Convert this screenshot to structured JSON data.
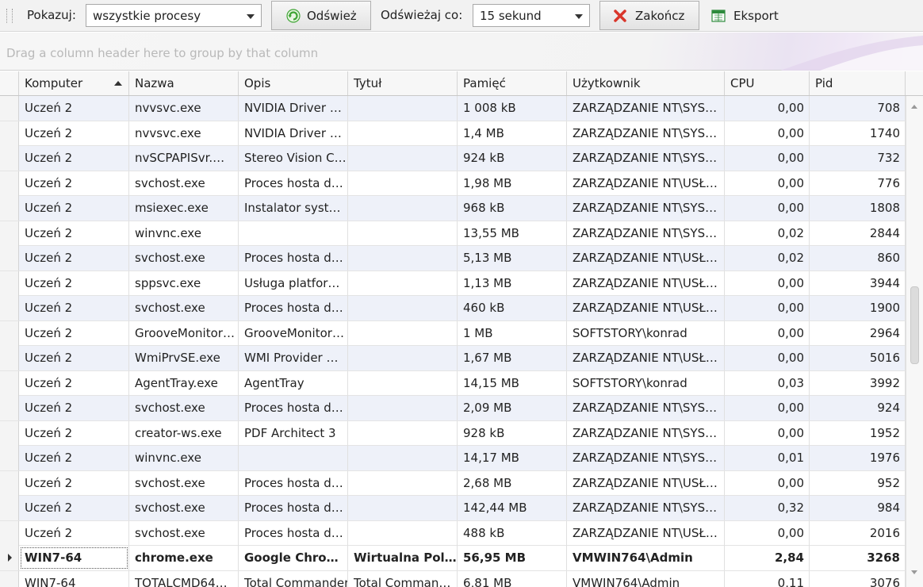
{
  "toolbar": {
    "show_label": "Pokazuj:",
    "show_value": "wszystkie procesy",
    "refresh_label": "Odśwież",
    "refresh_every_label": "Odświeżaj co:",
    "refresh_every_value": "15 sekund",
    "kill_label": "Zakończ",
    "export_label": "Eksport"
  },
  "group_panel": {
    "placeholder": "Drag a column header here to group by that column"
  },
  "columns": [
    "Komputer",
    "Nazwa",
    "Opis",
    "Tytuł",
    "Pamięć",
    "Użytkownik",
    "CPU",
    "Pid"
  ],
  "sorted_column": "Komputer",
  "rows": [
    {
      "komputer": "Uczeń 2",
      "nazwa": "nvvsvc.exe",
      "opis": "NVIDIA Driver …",
      "tytul": "",
      "pamiec": "1 008 kB",
      "uzytkownik": "ZARZĄDZANIE NT\\SYS…",
      "cpu": "0,00",
      "pid": "708"
    },
    {
      "komputer": "Uczeń 2",
      "nazwa": "nvvsvc.exe",
      "opis": "NVIDIA Driver …",
      "tytul": "",
      "pamiec": "1,4 MB",
      "uzytkownik": "ZARZĄDZANIE NT\\SYS…",
      "cpu": "0,00",
      "pid": "1740"
    },
    {
      "komputer": "Uczeń 2",
      "nazwa": "nvSCPAPISvr.…",
      "opis": "Stereo Vision C…",
      "tytul": "",
      "pamiec": "924 kB",
      "uzytkownik": "ZARZĄDZANIE NT\\SYS…",
      "cpu": "0,00",
      "pid": "732"
    },
    {
      "komputer": "Uczeń 2",
      "nazwa": "svchost.exe",
      "opis": "Proces hosta d…",
      "tytul": "",
      "pamiec": "1,98 MB",
      "uzytkownik": "ZARZĄDZANIE NT\\USŁ…",
      "cpu": "0,00",
      "pid": "776"
    },
    {
      "komputer": "Uczeń 2",
      "nazwa": "msiexec.exe",
      "opis": "Instalator syst…",
      "tytul": "",
      "pamiec": "968 kB",
      "uzytkownik": "ZARZĄDZANIE NT\\SYS…",
      "cpu": "0,00",
      "pid": "1808"
    },
    {
      "komputer": "Uczeń 2",
      "nazwa": "winvnc.exe",
      "opis": "",
      "tytul": "",
      "pamiec": "13,55 MB",
      "uzytkownik": "ZARZĄDZANIE NT\\SYS…",
      "cpu": "0,02",
      "pid": "2844"
    },
    {
      "komputer": "Uczeń 2",
      "nazwa": "svchost.exe",
      "opis": "Proces hosta d…",
      "tytul": "",
      "pamiec": "5,13 MB",
      "uzytkownik": "ZARZĄDZANIE NT\\USŁ…",
      "cpu": "0,02",
      "pid": "860"
    },
    {
      "komputer": "Uczeń 2",
      "nazwa": "sppsvc.exe",
      "opis": "Usługa platfor…",
      "tytul": "",
      "pamiec": "1,13 MB",
      "uzytkownik": "ZARZĄDZANIE NT\\USŁ…",
      "cpu": "0,00",
      "pid": "3944"
    },
    {
      "komputer": "Uczeń 2",
      "nazwa": "svchost.exe",
      "opis": "Proces hosta d…",
      "tytul": "",
      "pamiec": "460 kB",
      "uzytkownik": "ZARZĄDZANIE NT\\USŁ…",
      "cpu": "0,00",
      "pid": "1900"
    },
    {
      "komputer": "Uczeń 2",
      "nazwa": "GrooveMonitor…",
      "opis": "GrooveMonitor…",
      "tytul": "",
      "pamiec": "1 MB",
      "uzytkownik": "SOFTSTORY\\konrad",
      "cpu": "0,00",
      "pid": "2964"
    },
    {
      "komputer": "Uczeń 2",
      "nazwa": "WmiPrvSE.exe",
      "opis": "WMI Provider …",
      "tytul": "",
      "pamiec": "1,67 MB",
      "uzytkownik": "ZARZĄDZANIE NT\\USŁ…",
      "cpu": "0,00",
      "pid": "5016"
    },
    {
      "komputer": "Uczeń 2",
      "nazwa": "AgentTray.exe",
      "opis": "AgentTray",
      "tytul": "",
      "pamiec": "14,15 MB",
      "uzytkownik": "SOFTSTORY\\konrad",
      "cpu": "0,03",
      "pid": "3992"
    },
    {
      "komputer": "Uczeń 2",
      "nazwa": "svchost.exe",
      "opis": "Proces hosta d…",
      "tytul": "",
      "pamiec": "2,09 MB",
      "uzytkownik": "ZARZĄDZANIE NT\\SYS…",
      "cpu": "0,00",
      "pid": "924"
    },
    {
      "komputer": "Uczeń 2",
      "nazwa": "creator-ws.exe",
      "opis": "PDF Architect 3",
      "tytul": "",
      "pamiec": "928 kB",
      "uzytkownik": "ZARZĄDZANIE NT\\SYS…",
      "cpu": "0,00",
      "pid": "1952"
    },
    {
      "komputer": "Uczeń 2",
      "nazwa": "winvnc.exe",
      "opis": "",
      "tytul": "",
      "pamiec": "14,17 MB",
      "uzytkownik": "ZARZĄDZANIE NT\\SYS…",
      "cpu": "0,01",
      "pid": "1976"
    },
    {
      "komputer": "Uczeń 2",
      "nazwa": "svchost.exe",
      "opis": "Proces hosta d…",
      "tytul": "",
      "pamiec": "2,68 MB",
      "uzytkownik": "ZARZĄDZANIE NT\\USŁ…",
      "cpu": "0,00",
      "pid": "952"
    },
    {
      "komputer": "Uczeń 2",
      "nazwa": "svchost.exe",
      "opis": "Proces hosta d…",
      "tytul": "",
      "pamiec": "142,44 MB",
      "uzytkownik": "ZARZĄDZANIE NT\\SYS…",
      "cpu": "0,32",
      "pid": "984"
    },
    {
      "komputer": "Uczeń 2",
      "nazwa": "svchost.exe",
      "opis": "Proces hosta d…",
      "tytul": "",
      "pamiec": "488 kB",
      "uzytkownik": "ZARZĄDZANIE NT\\USŁ…",
      "cpu": "0,00",
      "pid": "2016"
    },
    {
      "komputer": "WIN7-64",
      "nazwa": "chrome.exe",
      "opis": "Google Chro…",
      "tytul": "Wirtualna Pol…",
      "pamiec": "56,95 MB",
      "uzytkownik": "VMWIN764\\Admin",
      "cpu": "2,84",
      "pid": "3268",
      "focused": true
    },
    {
      "komputer": "WIN7-64",
      "nazwa": "TOTALCMD64…",
      "opis": "Total Commander",
      "tytul": "Total Comman…",
      "pamiec": "6,81 MB",
      "uzytkownik": "VMWIN764\\Admin",
      "cpu": "0,11",
      "pid": "3076"
    }
  ],
  "icons": {
    "refresh": "refresh-icon",
    "kill": "red-x-icon",
    "export": "excel-export-icon"
  },
  "colors": {
    "alt_row": "#eef1f9",
    "kill_icon": "#d9362b",
    "refresh_icon": "#3fa535",
    "export_icon": "#2e8b3d"
  }
}
